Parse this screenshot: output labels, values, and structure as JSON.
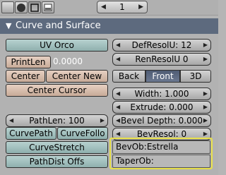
{
  "toolbar": {
    "page_value": "1"
  },
  "panel": {
    "title": "Curve and Surface",
    "uv_orco": "UV Orco",
    "printlen": "PrintLen",
    "printlen_value": "0.0000",
    "center": "Center",
    "center_new": "Center New",
    "center_cursor": "Center Cursor",
    "pathlen": "PathLen: 100",
    "curvepath": "CurvePath",
    "curvefollow": "CurveFollo",
    "curvestretch": "CurveStretch",
    "pathdist_offs": "PathDist Offs",
    "defresolu": "DefResolU: 12",
    "renresolu": "RenResolU 0",
    "back": "Back",
    "front": "Front",
    "three_d": "3D",
    "width": "Width: 1.000",
    "extrude": "Extrude: 0.000",
    "bevel_depth": "Bevel Depth: 0.000",
    "bevresol": "BevResol: 0",
    "bevob": "BevOb:Estrella",
    "taperob": "TaperOb:"
  },
  "colors": {
    "header": "#5d6a7e",
    "active_segment": "#5a6780",
    "highlight": "#e8e04a"
  }
}
